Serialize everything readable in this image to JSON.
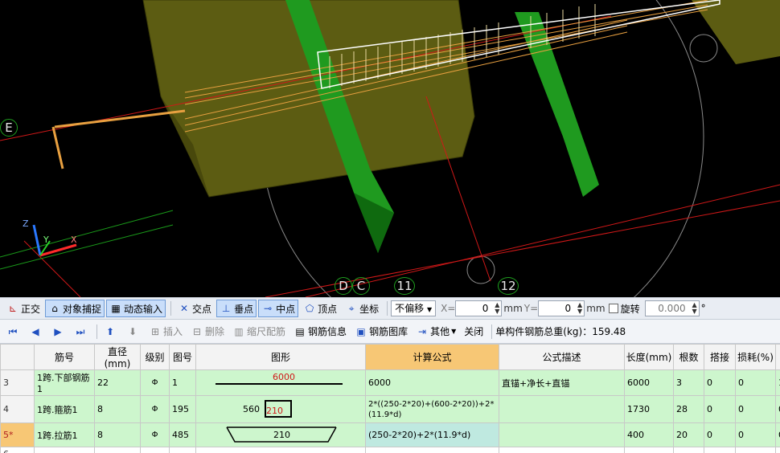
{
  "viewport": {
    "axis_labels": [
      {
        "id": "E",
        "text": "E"
      },
      {
        "id": "D",
        "text": "D"
      },
      {
        "id": "C",
        "text": "C"
      },
      {
        "id": "11",
        "text": "11"
      },
      {
        "id": "12",
        "text": "12"
      }
    ],
    "triad": {
      "z": "Z",
      "y": "Y",
      "x": "X"
    }
  },
  "toolbar1": {
    "ortho": "正交",
    "object_snap": "对象捕捉",
    "dynamic_input": "动态输入",
    "intersection": "交点",
    "perpendicular": "垂点",
    "midpoint": "中点",
    "vertex": "顶点",
    "coordinate": "坐标",
    "offset_mode": "不偏移",
    "x_label": "X=",
    "x_value": "0",
    "x_unit": "mm",
    "y_label": "Y=",
    "y_value": "0",
    "y_unit": "mm",
    "rotate": "旋转",
    "rotate_value": "0.000",
    "degree": "°"
  },
  "toolbar2": {
    "insert": "插入",
    "delete": "删除",
    "scale_rebar": "缩尺配筋",
    "rebar_info": "钢筋信息",
    "rebar_library": "钢筋图库",
    "other": "其他",
    "close": "关闭",
    "total_weight_label": "单构件钢筋总重(kg)：",
    "total_weight_value": "159.48"
  },
  "grid": {
    "headers": [
      "",
      "筋号",
      "直径(mm)",
      "级别",
      "图号",
      "图形",
      "计算公式",
      "公式描述",
      "长度(mm)",
      "根数",
      "搭接",
      "损耗(%)",
      "单"
    ],
    "rows": [
      {
        "num": "3",
        "name": "1跨.下部钢筋1",
        "dia": "22",
        "grade": "Φ",
        "fig": "1",
        "shape_label": "6000",
        "formula": "6000",
        "desc": "直锚+净长+直锚",
        "len": "6000",
        "count": "3",
        "lap": "0",
        "loss": "0",
        "unit": "1"
      },
      {
        "num": "4",
        "name": "1跨.箍筋1",
        "dia": "8",
        "grade": "Φ",
        "fig": "195",
        "shape_label_a": "560",
        "shape_label_b": "210",
        "formula": "2*((250-2*20)+(600-2*20))+2*(11.9*d)",
        "desc": "",
        "len": "1730",
        "count": "28",
        "lap": "0",
        "loss": "0",
        "unit": "0"
      },
      {
        "num": "5*",
        "name": "1跨.拉筋1",
        "dia": "8",
        "grade": "Φ",
        "fig": "485",
        "shape_label": "210",
        "formula": "(250-2*20)+2*(11.9*d)",
        "desc": "",
        "len": "400",
        "count": "20",
        "lap": "0",
        "loss": "0",
        "unit": "0"
      },
      {
        "num": "6",
        "name": "",
        "dia": "",
        "grade": "",
        "fig": "",
        "formula": "",
        "desc": "",
        "len": "",
        "count": "",
        "lap": "",
        "loss": "",
        "unit": ""
      }
    ]
  },
  "colors": {
    "viewport_bg": "#000000",
    "beam_olive": "#5a5a10",
    "column_green": "#22a822",
    "rebar_orange": "#e8a040",
    "axis_red": "#e02020",
    "grid_green": "#cdf6cd",
    "selected_orange": "#f7c775"
  }
}
